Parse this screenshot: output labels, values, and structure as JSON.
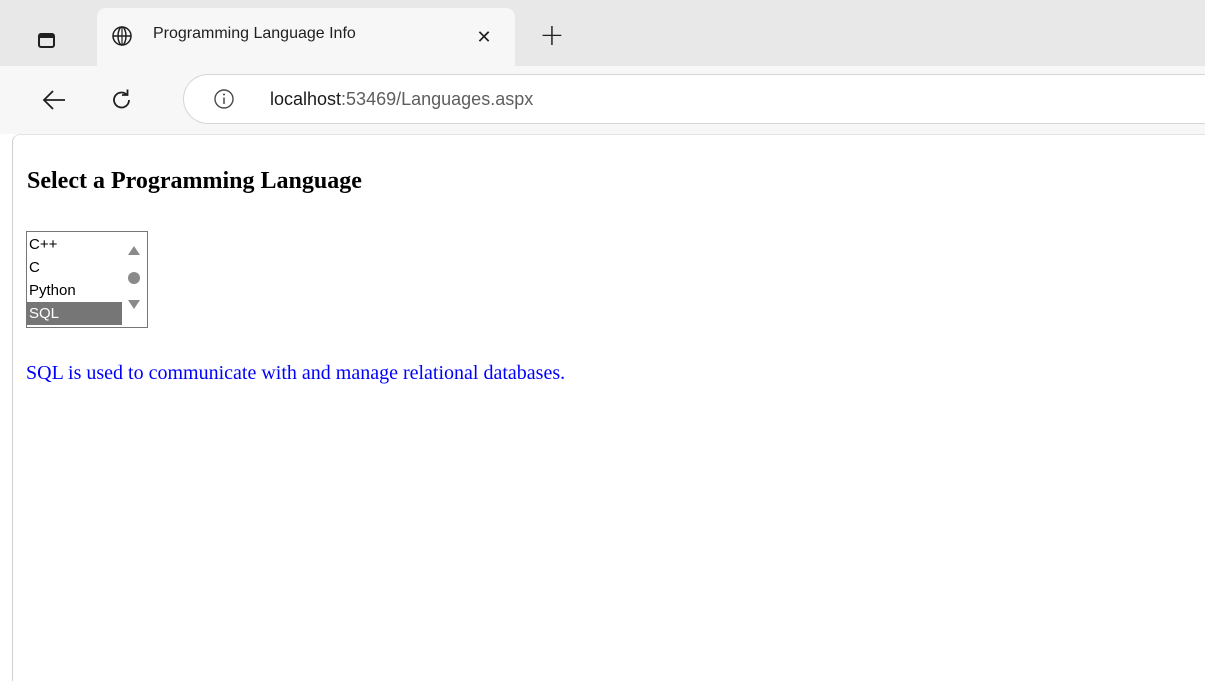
{
  "browser": {
    "tab": {
      "title": "Programming Language Info",
      "close_symbol": "✕",
      "icon": "globe-icon"
    },
    "new_tab_symbol": "+",
    "address": {
      "host": "localhost",
      "path": ":53469/Languages.aspx",
      "icon": "info-icon"
    },
    "icons": {
      "sidebar": "sidebar-toggle-icon",
      "back": "back-arrow-icon",
      "reload": "reload-icon"
    }
  },
  "page": {
    "heading": "Select a Programming Language",
    "listbox": {
      "options": [
        "C++",
        "C",
        "Python",
        "SQL"
      ],
      "selected": "SQL",
      "selected_color": "#767676"
    },
    "description": "SQL is used to communicate with and manage relational databases.",
    "description_color": "#0000ff"
  }
}
